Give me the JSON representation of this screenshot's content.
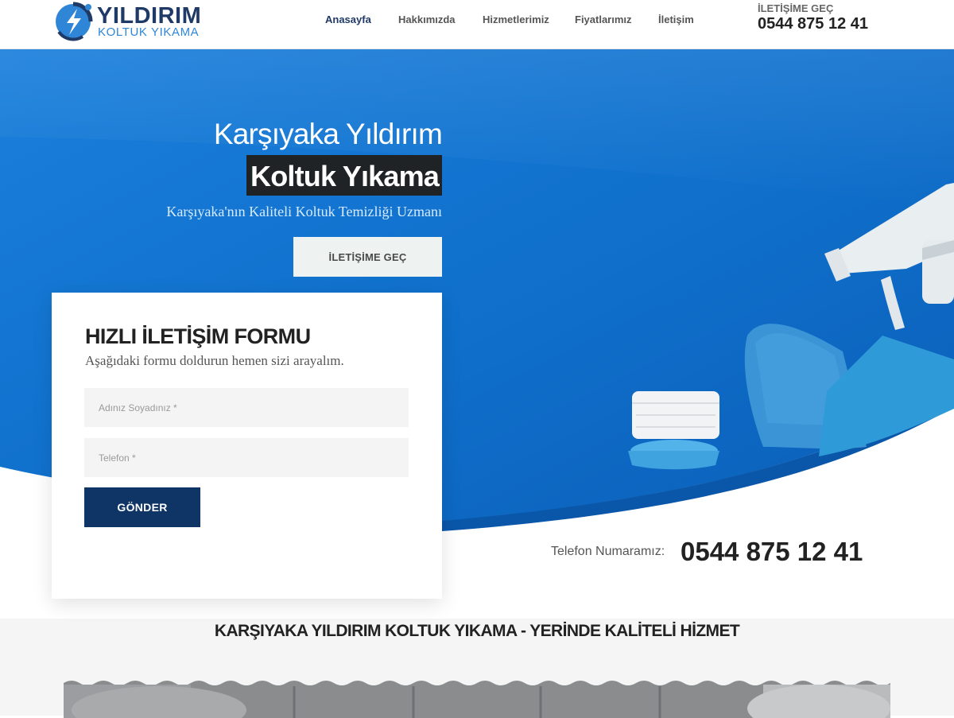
{
  "header": {
    "logo_title": "YILDIRIM",
    "logo_subtitle": "KOLTUK YIKAMA",
    "nav": [
      {
        "label": "Anasayfa",
        "active": true
      },
      {
        "label": "Hakkımızda",
        "active": false
      },
      {
        "label": "Hizmetlerimiz",
        "active": false
      },
      {
        "label": "Fiyatlarımız",
        "active": false
      },
      {
        "label": "İletişim",
        "active": false
      }
    ],
    "contact_label": "İLETİŞİME GEÇ",
    "contact_phone": "0544 875 12 41"
  },
  "hero": {
    "title_line1": "Karşıyaka Yıldırım",
    "title_line2": "Koltuk Yıkama",
    "subtitle": "Karşıyaka'nın Kaliteli Koltuk Temizliği Uzmanı",
    "cta_label": "İLETİŞİME GEÇ"
  },
  "form": {
    "title": "HIZLI İLETİŞİM FORMU",
    "description": "Aşağıdaki formu doldurun hemen sizi arayalım.",
    "name_placeholder": "Adınız Soyadınız *",
    "phone_placeholder": "Telefon *",
    "submit_label": "GÖNDER"
  },
  "phone_band": {
    "label": "Telefon Numaramız:",
    "value": "0544 875 12 41"
  },
  "section": {
    "title": "KARŞIYAKA YILDIRIM KOLTUK YIKAMA - YERİNDE KALİTELİ HİZMET"
  },
  "colors": {
    "brand_navy": "#1f3a66",
    "brand_blue": "#2f86d6",
    "hero_blue": "#1478d4",
    "submit_navy": "#0e3566"
  },
  "icons": [
    "lightning-logo-icon",
    "spray-bottle-icon",
    "cleaning-brush-icon",
    "microfiber-cloth-icon",
    "sponge-icon"
  ]
}
